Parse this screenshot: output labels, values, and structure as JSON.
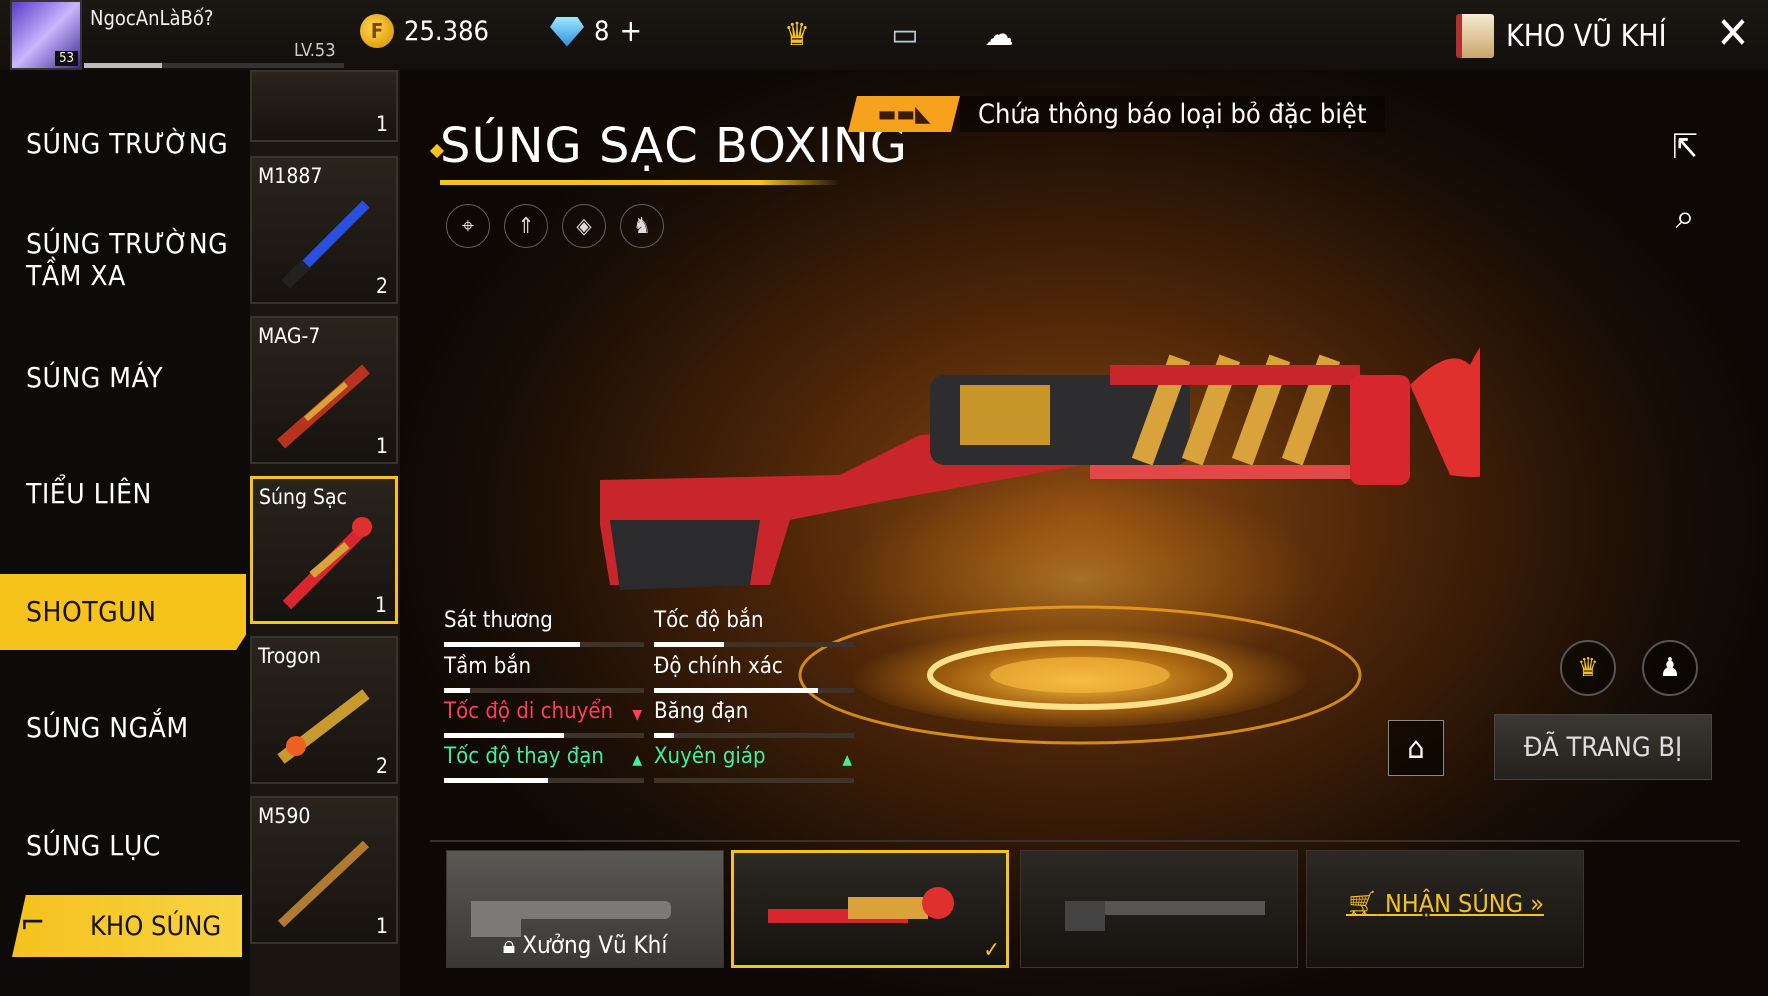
{
  "player": {
    "name": "NgocAnLàBố?",
    "level": "LV.53",
    "badge_level": "53"
  },
  "currency": {
    "coins": "25.386",
    "diamonds": "8"
  },
  "header": {
    "title": "KHO VŨ KHÍ"
  },
  "categories": [
    {
      "label": "SÚNG TRƯỜNG"
    },
    {
      "label": "SÚNG TRƯỜNG\nTẦM XA"
    },
    {
      "label": "SÚNG MÁY"
    },
    {
      "label": "TIỂU LIÊN"
    },
    {
      "label": "SHOTGUN",
      "active": true
    },
    {
      "label": "SÚNG NGẮM"
    },
    {
      "label": "SÚNG LỤC"
    }
  ],
  "khosung_label": "KHO SÚNG",
  "weapons": [
    {
      "name": "",
      "count": "1"
    },
    {
      "name": "M1887",
      "count": "2"
    },
    {
      "name": "MAG-7",
      "count": "1"
    },
    {
      "name": "Súng Sạc",
      "count": "1",
      "selected": true
    },
    {
      "name": "Trogon",
      "count": "2"
    },
    {
      "name": "M590",
      "count": "1"
    }
  ],
  "selected_weapon": {
    "title": "SÚNG SẠC BOXING"
  },
  "notice": {
    "text": "Chứa thông báo loại bỏ đặc biệt"
  },
  "stats": {
    "damage": {
      "label": "Sát thương",
      "value": 0.68
    },
    "fire_rate": {
      "label": "Tốc độ bắn",
      "value": 0.35
    },
    "range": {
      "label": "Tầm bắn",
      "value": 0.13
    },
    "accuracy": {
      "label": "Độ chính xác",
      "value": 0.82
    },
    "move_speed": {
      "label": "Tốc độ di chuyển",
      "value": 0.6
    },
    "magazine": {
      "label": "Băng đạn",
      "value": 0.1
    },
    "reload": {
      "label": "Tốc độ thay đạn",
      "value": 0.52
    },
    "armor_pen": {
      "label": "Xuyên giáp",
      "value": 0.0
    }
  },
  "equip_button": "ĐÃ TRANG BỊ",
  "slots": {
    "workshop": "Xưởng Vũ Khí",
    "get_gun": "NHẬN SÚNG"
  },
  "colors": {
    "accent": "#f6c21c",
    "red_stat": "#ff3f55",
    "green_stat": "#3fef9c"
  }
}
